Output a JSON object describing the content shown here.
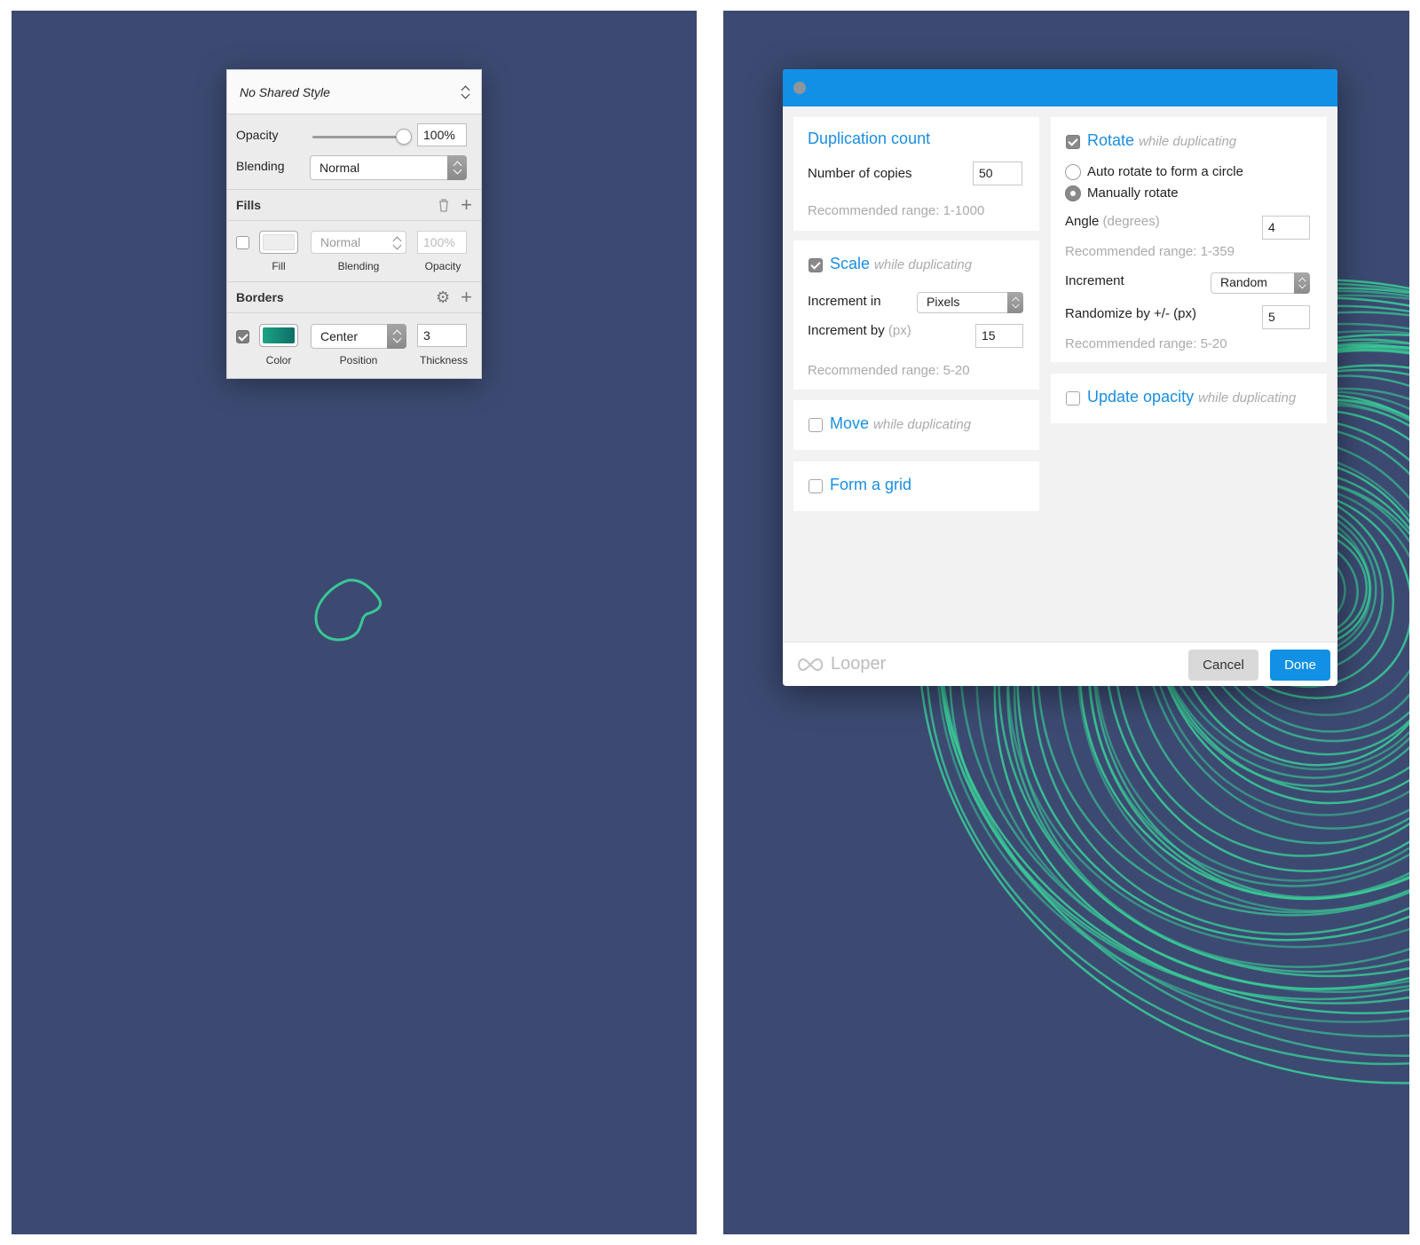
{
  "inspector": {
    "shared_style": "No Shared Style",
    "opacity_label": "Opacity",
    "opacity_value": "100%",
    "opacity_slider_fraction": 1.0,
    "blending_label": "Blending",
    "blending_value": "Normal",
    "fills": {
      "title": "Fills",
      "enabled": false,
      "blending": "Normal",
      "opacity": "100%",
      "labels": {
        "fill": "Fill",
        "blending": "Blending",
        "opacity": "Opacity"
      },
      "swatch_color": "#eeeeee"
    },
    "borders": {
      "title": "Borders",
      "enabled": true,
      "position": "Center",
      "thickness": "3",
      "labels": {
        "color": "Color",
        "position": "Position",
        "thickness": "Thickness"
      },
      "swatch_color_start": "#1ca583",
      "swatch_color_end": "#0e6d68"
    }
  },
  "canvas": {
    "background": "#3c4a72",
    "stroke_color": "#39c895"
  },
  "looper": {
    "duplication": {
      "title": "Duplication count",
      "copies_label": "Number of copies",
      "copies_value": "50",
      "hint": "Recommended range: 1-1000"
    },
    "scale": {
      "enabled": true,
      "title": "Scale",
      "subtitle": "while duplicating",
      "increment_in_label": "Increment in",
      "increment_in_value": "Pixels",
      "increment_by_label": "Increment by",
      "increment_by_unit": "(px)",
      "increment_by_value": "15",
      "hint": "Recommended range: 5-20"
    },
    "move": {
      "enabled": false,
      "title": "Move",
      "subtitle": "while duplicating"
    },
    "grid": {
      "enabled": false,
      "title": "Form a grid"
    },
    "rotate": {
      "enabled": true,
      "title": "Rotate",
      "subtitle": "while duplicating",
      "option_auto": "Auto rotate to form a circle",
      "option_manual": "Manually rotate",
      "selected": "manual",
      "angle_label": "Angle",
      "angle_unit": "(degrees)",
      "angle_value": "4",
      "angle_hint": "Recommended range: 1-359",
      "increment_label": "Increment",
      "increment_value": "Random",
      "randomize_label": "Randomize by +/- (px)",
      "randomize_value": "5",
      "randomize_hint": "Recommended range: 5-20"
    },
    "opacity": {
      "enabled": false,
      "title": "Update opacity",
      "subtitle": "while duplicating"
    },
    "footer": {
      "brand": "Looper",
      "cancel": "Cancel",
      "done": "Done"
    },
    "accent": "#1190e6"
  }
}
